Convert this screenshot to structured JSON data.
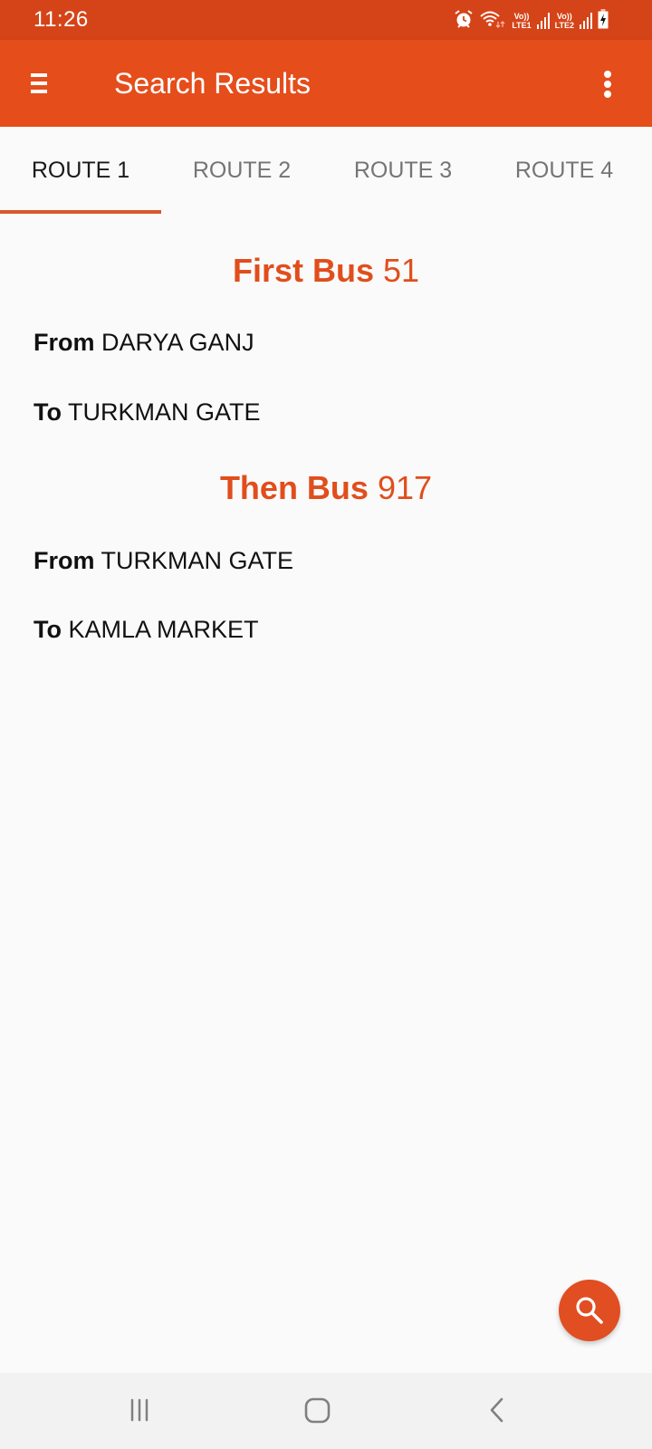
{
  "status_bar": {
    "time": "11:26",
    "icons": [
      "alarm-icon",
      "wifi-icon",
      "volte-lte1-signal-icon",
      "volte-lte2-signal-icon",
      "battery-charging-icon"
    ],
    "sim1_label_top": "Vo))",
    "sim1_label_bottom": "LTE1",
    "sim2_label_top": "Vo))",
    "sim2_label_bottom": "LTE2"
  },
  "app_bar": {
    "title": "Search Results",
    "menu_icon": "hamburger-menu-icon",
    "overflow_icon": "more-vert-icon"
  },
  "tabs": [
    {
      "label": "ROUTE 1",
      "active": true
    },
    {
      "label": "ROUTE 2",
      "active": false
    },
    {
      "label": "ROUTE 3",
      "active": false
    },
    {
      "label": "ROUTE 4",
      "active": false
    }
  ],
  "route": {
    "legs": [
      {
        "heading_prefix": "First Bus",
        "bus_number": "51",
        "from_label": "From",
        "from": "DARYA GANJ",
        "to_label": "To",
        "to": "TURKMAN GATE"
      },
      {
        "heading_prefix": "Then Bus",
        "bus_number": "917",
        "from_label": "From",
        "from": "TURKMAN GATE",
        "to_label": "To",
        "to": "KAMLA MARKET"
      }
    ]
  },
  "fab": {
    "icon": "search-icon"
  },
  "nav_bar": {
    "buttons": [
      "recent-apps-icon",
      "home-icon",
      "back-icon"
    ]
  },
  "colors": {
    "status_bar": "#d54418",
    "app_bar": "#e54d1b",
    "accent": "#e04e1c",
    "tab_indicator": "#d9572b",
    "background": "#fafafa",
    "nav_bar": "#f2f2f2"
  }
}
